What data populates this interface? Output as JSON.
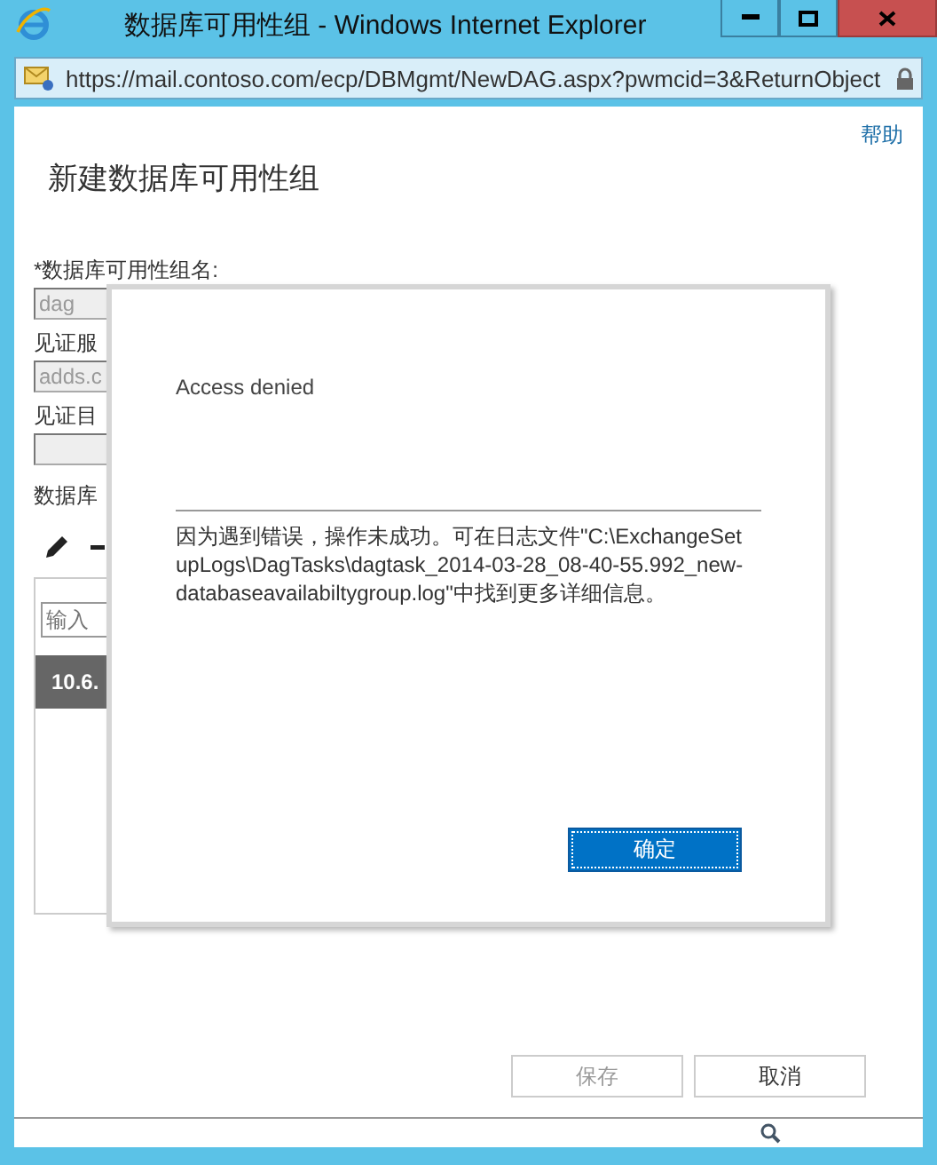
{
  "window": {
    "title": "数据库可用性组 - Windows Internet Explorer",
    "url": "https://mail.contoso.com/ecp/DBMgmt/NewDAG.aspx?pwmcid=3&ReturnObject"
  },
  "page": {
    "help_link": "帮助",
    "heading": "新建数据库可用性组",
    "fields": [
      {
        "label": "*数据库可用性组名:",
        "value": "dag",
        "disabled": true
      },
      {
        "label": "见证服",
        "value": "adds.c",
        "disabled": true
      },
      {
        "label": "见证目",
        "disabled": true
      }
    ],
    "section_label": "数据库",
    "list": {
      "search_placeholder": "输入",
      "rows": [
        {
          "text": "10.6.",
          "selected": true
        }
      ]
    },
    "buttons": [
      {
        "label": "保存",
        "disabled": true
      },
      {
        "label": "取消",
        "disabled": false
      }
    ]
  },
  "dialog": {
    "title": "Access denied",
    "message": "因为遇到错误，操作未成功。可在日志文件\"C:\\ExchangeSetupLogs\\DagTasks\\dagtask_2014-03-28_08-40-55.992_new-databaseavailabiltygroup.log\"中找到更多详细信息。",
    "button": "确定"
  }
}
